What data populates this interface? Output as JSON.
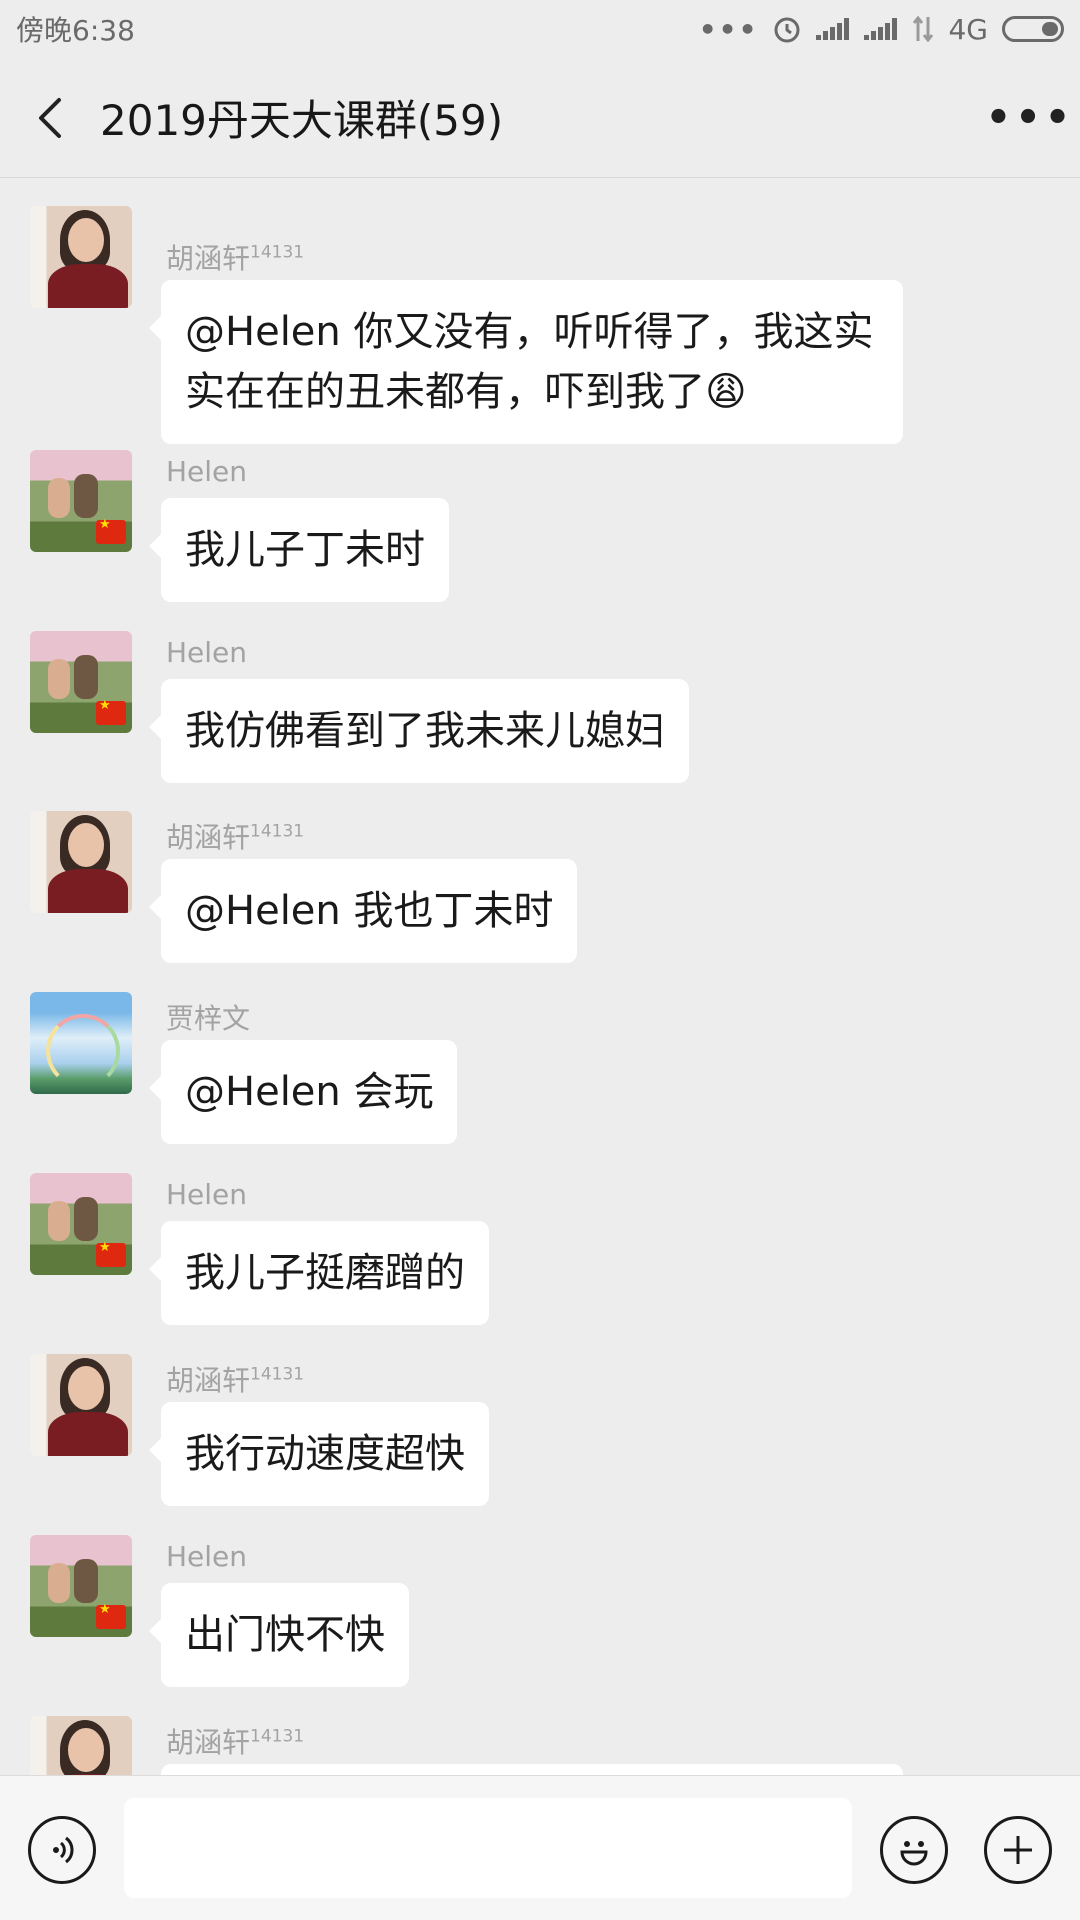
{
  "status_bar": {
    "time": "傍晚6:38",
    "network": "4G",
    "icons": [
      "more-dots-icon",
      "alarm-icon",
      "signal-icon",
      "signal-icon",
      "data-arrows-icon",
      "battery-icon"
    ]
  },
  "header": {
    "title": "2019丹天大课群(59)",
    "back_icon": "chevron-left-icon",
    "more_icon": "more-horizontal-icon"
  },
  "messages": [
    {
      "sender": "胡涵轩",
      "sender_sup": "14131",
      "text": "@Helen  你又没有，听听得了，我这实实在在的丑未都有，吓到我了😩"
    },
    {
      "sender": "Helen",
      "sender_sup": "",
      "text": "我儿子丁未时"
    },
    {
      "sender": "Helen",
      "sender_sup": "",
      "text": "我仿佛看到了我未来儿媳妇"
    },
    {
      "sender": "胡涵轩",
      "sender_sup": "14131",
      "text": "@Helen  我也丁未时"
    },
    {
      "sender": "贾梓文",
      "sender_sup": "",
      "text": "@Helen  会玩"
    },
    {
      "sender": "Helen",
      "sender_sup": "",
      "text": "我儿子挺磨蹭的"
    },
    {
      "sender": "胡涵轩",
      "sender_sup": "14131",
      "text": "我行动速度超快"
    },
    {
      "sender": "Helen",
      "sender_sup": "",
      "text": "出门快不快"
    },
    {
      "sender": "胡涵轩",
      "sender_sup": "14131",
      "text": ""
    }
  ],
  "input_bar": {
    "voice_icon": "voice-icon",
    "emoji_icon": "emoji-icon",
    "plus_icon": "plus-icon",
    "input_value": ""
  },
  "colors": {
    "background": "#ededed",
    "bubble": "#ffffff",
    "sender_name": "#a3a3a3",
    "flag_red": "#de2910"
  }
}
